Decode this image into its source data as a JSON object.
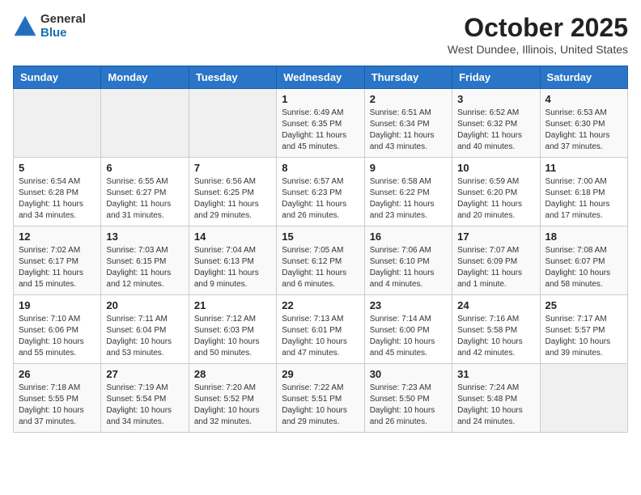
{
  "header": {
    "logo_general": "General",
    "logo_blue": "Blue",
    "month_title": "October 2025",
    "location": "West Dundee, Illinois, United States"
  },
  "weekdays": [
    "Sunday",
    "Monday",
    "Tuesday",
    "Wednesday",
    "Thursday",
    "Friday",
    "Saturday"
  ],
  "weeks": [
    [
      {
        "day": "",
        "info": ""
      },
      {
        "day": "",
        "info": ""
      },
      {
        "day": "",
        "info": ""
      },
      {
        "day": "1",
        "info": "Sunrise: 6:49 AM\nSunset: 6:35 PM\nDaylight: 11 hours\nand 45 minutes."
      },
      {
        "day": "2",
        "info": "Sunrise: 6:51 AM\nSunset: 6:34 PM\nDaylight: 11 hours\nand 43 minutes."
      },
      {
        "day": "3",
        "info": "Sunrise: 6:52 AM\nSunset: 6:32 PM\nDaylight: 11 hours\nand 40 minutes."
      },
      {
        "day": "4",
        "info": "Sunrise: 6:53 AM\nSunset: 6:30 PM\nDaylight: 11 hours\nand 37 minutes."
      }
    ],
    [
      {
        "day": "5",
        "info": "Sunrise: 6:54 AM\nSunset: 6:28 PM\nDaylight: 11 hours\nand 34 minutes."
      },
      {
        "day": "6",
        "info": "Sunrise: 6:55 AM\nSunset: 6:27 PM\nDaylight: 11 hours\nand 31 minutes."
      },
      {
        "day": "7",
        "info": "Sunrise: 6:56 AM\nSunset: 6:25 PM\nDaylight: 11 hours\nand 29 minutes."
      },
      {
        "day": "8",
        "info": "Sunrise: 6:57 AM\nSunset: 6:23 PM\nDaylight: 11 hours\nand 26 minutes."
      },
      {
        "day": "9",
        "info": "Sunrise: 6:58 AM\nSunset: 6:22 PM\nDaylight: 11 hours\nand 23 minutes."
      },
      {
        "day": "10",
        "info": "Sunrise: 6:59 AM\nSunset: 6:20 PM\nDaylight: 11 hours\nand 20 minutes."
      },
      {
        "day": "11",
        "info": "Sunrise: 7:00 AM\nSunset: 6:18 PM\nDaylight: 11 hours\nand 17 minutes."
      }
    ],
    [
      {
        "day": "12",
        "info": "Sunrise: 7:02 AM\nSunset: 6:17 PM\nDaylight: 11 hours\nand 15 minutes."
      },
      {
        "day": "13",
        "info": "Sunrise: 7:03 AM\nSunset: 6:15 PM\nDaylight: 11 hours\nand 12 minutes."
      },
      {
        "day": "14",
        "info": "Sunrise: 7:04 AM\nSunset: 6:13 PM\nDaylight: 11 hours\nand 9 minutes."
      },
      {
        "day": "15",
        "info": "Sunrise: 7:05 AM\nSunset: 6:12 PM\nDaylight: 11 hours\nand 6 minutes."
      },
      {
        "day": "16",
        "info": "Sunrise: 7:06 AM\nSunset: 6:10 PM\nDaylight: 11 hours\nand 4 minutes."
      },
      {
        "day": "17",
        "info": "Sunrise: 7:07 AM\nSunset: 6:09 PM\nDaylight: 11 hours\nand 1 minute."
      },
      {
        "day": "18",
        "info": "Sunrise: 7:08 AM\nSunset: 6:07 PM\nDaylight: 10 hours\nand 58 minutes."
      }
    ],
    [
      {
        "day": "19",
        "info": "Sunrise: 7:10 AM\nSunset: 6:06 PM\nDaylight: 10 hours\nand 55 minutes."
      },
      {
        "day": "20",
        "info": "Sunrise: 7:11 AM\nSunset: 6:04 PM\nDaylight: 10 hours\nand 53 minutes."
      },
      {
        "day": "21",
        "info": "Sunrise: 7:12 AM\nSunset: 6:03 PM\nDaylight: 10 hours\nand 50 minutes."
      },
      {
        "day": "22",
        "info": "Sunrise: 7:13 AM\nSunset: 6:01 PM\nDaylight: 10 hours\nand 47 minutes."
      },
      {
        "day": "23",
        "info": "Sunrise: 7:14 AM\nSunset: 6:00 PM\nDaylight: 10 hours\nand 45 minutes."
      },
      {
        "day": "24",
        "info": "Sunrise: 7:16 AM\nSunset: 5:58 PM\nDaylight: 10 hours\nand 42 minutes."
      },
      {
        "day": "25",
        "info": "Sunrise: 7:17 AM\nSunset: 5:57 PM\nDaylight: 10 hours\nand 39 minutes."
      }
    ],
    [
      {
        "day": "26",
        "info": "Sunrise: 7:18 AM\nSunset: 5:55 PM\nDaylight: 10 hours\nand 37 minutes."
      },
      {
        "day": "27",
        "info": "Sunrise: 7:19 AM\nSunset: 5:54 PM\nDaylight: 10 hours\nand 34 minutes."
      },
      {
        "day": "28",
        "info": "Sunrise: 7:20 AM\nSunset: 5:52 PM\nDaylight: 10 hours\nand 32 minutes."
      },
      {
        "day": "29",
        "info": "Sunrise: 7:22 AM\nSunset: 5:51 PM\nDaylight: 10 hours\nand 29 minutes."
      },
      {
        "day": "30",
        "info": "Sunrise: 7:23 AM\nSunset: 5:50 PM\nDaylight: 10 hours\nand 26 minutes."
      },
      {
        "day": "31",
        "info": "Sunrise: 7:24 AM\nSunset: 5:48 PM\nDaylight: 10 hours\nand 24 minutes."
      },
      {
        "day": "",
        "info": ""
      }
    ]
  ]
}
